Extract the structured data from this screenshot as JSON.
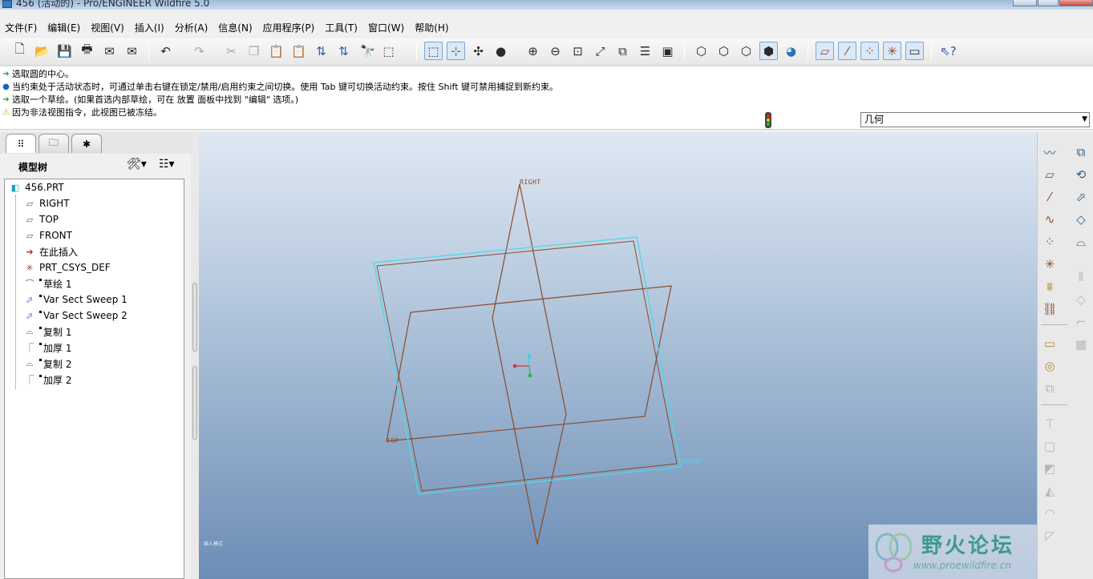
{
  "window": {
    "title": "456 (活动的) - Pro/ENGINEER Wildfire 5.0"
  },
  "menu": [
    "文件(F)",
    "编辑(E)",
    "视图(V)",
    "插入(I)",
    "分析(A)",
    "信息(N)",
    "应用程序(P)",
    "工具(T)",
    "窗口(W)",
    "帮助(H)"
  ],
  "toolbar": {
    "buttons": [
      "new-file-icon",
      "open-file-icon",
      "save-icon",
      "print-icon",
      "send-mail-icon",
      "send-mail-attach-icon",
      "undo-icon",
      "redo-icon",
      "cut-icon",
      "copy-icon",
      "paste-icon",
      "paste-special-icon",
      "regenerate-icon",
      "regen-manager-icon",
      "find-icon",
      "select-box-icon",
      "repaint-icon",
      "spin-center-icon",
      "orient-mode-icon",
      "appearance-ball-icon",
      "zoom-in-icon",
      "zoom-out-icon",
      "refit-icon",
      "reorient-icon",
      "saved-views-icon",
      "layers-icon",
      "view-manager-icon",
      "wireframe-icon",
      "hidden-line-icon",
      "no-hidden-icon",
      "shading-icon",
      "enhanced-realism-icon",
      "datum-planes-icon",
      "datum-axes-icon",
      "datum-points-icon",
      "coord-systems-icon",
      "annotations-icon",
      "context-help-icon"
    ]
  },
  "messages": [
    {
      "icon": "arrow-green",
      "text": "选取圆的中心。"
    },
    {
      "icon": "dot-blue",
      "text": "当约束处于活动状态时，可通过单击右键在锁定/禁用/启用约束之间切换。使用 Tab 键可切换活动约束。按住 Shift 键可禁用捕捉到新约束。"
    },
    {
      "icon": "arrow-green",
      "text": "选取一个草绘。(如果首选内部草绘，可在 放置 面板中找到 \"编辑\" 选项。)"
    },
    {
      "icon": "warning",
      "text": "因为非法视图指令，此视图已被冻结。"
    }
  ],
  "filter": {
    "value": "几何"
  },
  "model_tree": {
    "title": "模型树",
    "items": [
      {
        "label": "456.PRT",
        "icon": "part-icon"
      },
      {
        "label": "RIGHT",
        "icon": "datum-plane-icon"
      },
      {
        "label": "TOP",
        "icon": "datum-plane-icon"
      },
      {
        "label": "FRONT",
        "icon": "datum-plane-icon"
      },
      {
        "label": "在此插入",
        "icon": "insert-here-arrow-icon"
      },
      {
        "label": "PRT_CSYS_DEF",
        "icon": "coordinate-system-icon"
      },
      {
        "label": "草绘 1",
        "icon": "sketch-icon"
      },
      {
        "label": "Var Sect Sweep 1",
        "icon": "var-sect-sweep-icon"
      },
      {
        "label": "Var Sect Sweep 2",
        "icon": "var-sect-sweep-icon"
      },
      {
        "label": "复制 1",
        "icon": "copy-surface-icon"
      },
      {
        "label": "加厚 1",
        "icon": "thicken-icon"
      },
      {
        "label": "复制 2",
        "icon": "copy-surface-icon"
      },
      {
        "label": "加厚 2",
        "icon": "thicken-icon"
      }
    ]
  },
  "viewport": {
    "plane_labels": {
      "right": "RIGHT",
      "top": "TOP",
      "front": "FRONT"
    },
    "corner_hint": "插入模式",
    "plane_color": "#8a4b2c",
    "selected_color": "#4fd8ea"
  },
  "watermark": {
    "title": "野火论坛",
    "url": "www.proewildfire.cn"
  },
  "right_toolbar": {
    "buttons": [
      "sketch-tool-icon",
      "plane-tool-icon",
      "axis-tool-icon",
      "curve-tool-icon",
      "point-tool-icon",
      "csys-tool-icon",
      "analysis-tool-icon",
      "insert-udf-icon",
      "extrude-icon",
      "revolve-icon",
      "variable-sweep-icon",
      "blend-icon",
      "boundary-blend-icon",
      "mirror-icon",
      "merge-icon",
      "trim-icon",
      "pattern-icon",
      "hole-icon",
      "shell-icon",
      "rib-icon",
      "draft-icon",
      "round-icon",
      "chamfer-icon",
      "annotation-tool-icon",
      "select-tool-icon",
      "intent-icon"
    ]
  }
}
